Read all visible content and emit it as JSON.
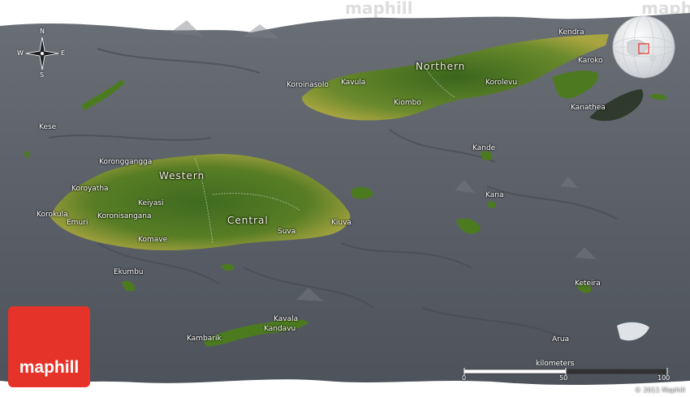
{
  "watermark": "maphill",
  "logo": {
    "text": "maphill"
  },
  "compass": {
    "n": "N",
    "s": "S",
    "e": "E",
    "w": "W"
  },
  "regions": [
    {
      "key": "northern",
      "label": "Northern"
    },
    {
      "key": "western",
      "label": "Western"
    },
    {
      "key": "central",
      "label": "Central"
    }
  ],
  "places": [
    {
      "key": "kendra",
      "label": "Kendra"
    },
    {
      "key": "karoko",
      "label": "Karoko"
    },
    {
      "key": "koroinasolo",
      "label": "Koroinasolo"
    },
    {
      "key": "kavula",
      "label": "Kavula"
    },
    {
      "key": "korolevu",
      "label": "Korolevu"
    },
    {
      "key": "kiombo",
      "label": "Kiombo"
    },
    {
      "key": "kanathea",
      "label": "Kanathea"
    },
    {
      "key": "kese",
      "label": "Kese"
    },
    {
      "key": "kande",
      "label": "Kande"
    },
    {
      "key": "korongangga",
      "label": "Koronggangga"
    },
    {
      "key": "koroyatha",
      "label": "Koroyatha"
    },
    {
      "key": "keiyasi",
      "label": "Keiyasi"
    },
    {
      "key": "kana",
      "label": "Kana"
    },
    {
      "key": "korokula",
      "label": "Korokula"
    },
    {
      "key": "koronisangana",
      "label": "Koronisangana"
    },
    {
      "key": "emuri",
      "label": "Emuri"
    },
    {
      "key": "suva",
      "label": "Suva"
    },
    {
      "key": "kiuva",
      "label": "Kiuva"
    },
    {
      "key": "komave",
      "label": "Komave"
    },
    {
      "key": "ekumbu",
      "label": "Ekumbu"
    },
    {
      "key": "keteira",
      "label": "Keteira"
    },
    {
      "key": "kavala",
      "label": "Kavala"
    },
    {
      "key": "kambarik",
      "label": "Kambarik"
    },
    {
      "key": "kandavu",
      "label": "Kandavu"
    },
    {
      "key": "arua",
      "label": "Arua"
    }
  ],
  "scale": {
    "title": "kilometers",
    "ticks": [
      "0",
      "50",
      "100"
    ]
  },
  "copyright": "© 2011 Maphill",
  "colors": {
    "sea": "#5a5f66",
    "land_dark": "#3f6a1c",
    "land_light": "#b8ad48",
    "logo": "#e63329"
  }
}
